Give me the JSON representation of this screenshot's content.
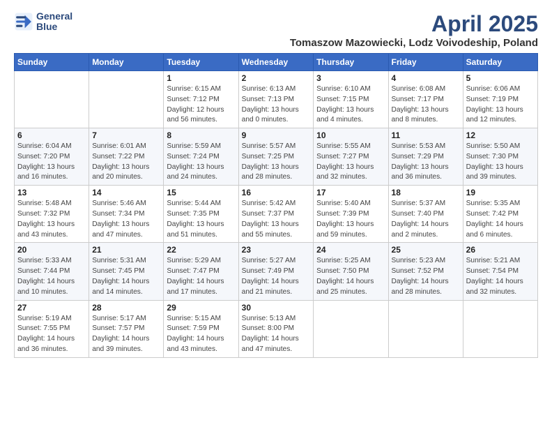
{
  "logo": {
    "line1": "General",
    "line2": "Blue"
  },
  "title": "April 2025",
  "subtitle": "Tomaszow Mazowiecki, Lodz Voivodeship, Poland",
  "header": {
    "days": [
      "Sunday",
      "Monday",
      "Tuesday",
      "Wednesday",
      "Thursday",
      "Friday",
      "Saturday"
    ]
  },
  "weeks": [
    [
      {
        "day": "",
        "info": ""
      },
      {
        "day": "",
        "info": ""
      },
      {
        "day": "1",
        "info": "Sunrise: 6:15 AM\nSunset: 7:12 PM\nDaylight: 12 hours and 56 minutes."
      },
      {
        "day": "2",
        "info": "Sunrise: 6:13 AM\nSunset: 7:13 PM\nDaylight: 13 hours and 0 minutes."
      },
      {
        "day": "3",
        "info": "Sunrise: 6:10 AM\nSunset: 7:15 PM\nDaylight: 13 hours and 4 minutes."
      },
      {
        "day": "4",
        "info": "Sunrise: 6:08 AM\nSunset: 7:17 PM\nDaylight: 13 hours and 8 minutes."
      },
      {
        "day": "5",
        "info": "Sunrise: 6:06 AM\nSunset: 7:19 PM\nDaylight: 13 hours and 12 minutes."
      }
    ],
    [
      {
        "day": "6",
        "info": "Sunrise: 6:04 AM\nSunset: 7:20 PM\nDaylight: 13 hours and 16 minutes."
      },
      {
        "day": "7",
        "info": "Sunrise: 6:01 AM\nSunset: 7:22 PM\nDaylight: 13 hours and 20 minutes."
      },
      {
        "day": "8",
        "info": "Sunrise: 5:59 AM\nSunset: 7:24 PM\nDaylight: 13 hours and 24 minutes."
      },
      {
        "day": "9",
        "info": "Sunrise: 5:57 AM\nSunset: 7:25 PM\nDaylight: 13 hours and 28 minutes."
      },
      {
        "day": "10",
        "info": "Sunrise: 5:55 AM\nSunset: 7:27 PM\nDaylight: 13 hours and 32 minutes."
      },
      {
        "day": "11",
        "info": "Sunrise: 5:53 AM\nSunset: 7:29 PM\nDaylight: 13 hours and 36 minutes."
      },
      {
        "day": "12",
        "info": "Sunrise: 5:50 AM\nSunset: 7:30 PM\nDaylight: 13 hours and 39 minutes."
      }
    ],
    [
      {
        "day": "13",
        "info": "Sunrise: 5:48 AM\nSunset: 7:32 PM\nDaylight: 13 hours and 43 minutes."
      },
      {
        "day": "14",
        "info": "Sunrise: 5:46 AM\nSunset: 7:34 PM\nDaylight: 13 hours and 47 minutes."
      },
      {
        "day": "15",
        "info": "Sunrise: 5:44 AM\nSunset: 7:35 PM\nDaylight: 13 hours and 51 minutes."
      },
      {
        "day": "16",
        "info": "Sunrise: 5:42 AM\nSunset: 7:37 PM\nDaylight: 13 hours and 55 minutes."
      },
      {
        "day": "17",
        "info": "Sunrise: 5:40 AM\nSunset: 7:39 PM\nDaylight: 13 hours and 59 minutes."
      },
      {
        "day": "18",
        "info": "Sunrise: 5:37 AM\nSunset: 7:40 PM\nDaylight: 14 hours and 2 minutes."
      },
      {
        "day": "19",
        "info": "Sunrise: 5:35 AM\nSunset: 7:42 PM\nDaylight: 14 hours and 6 minutes."
      }
    ],
    [
      {
        "day": "20",
        "info": "Sunrise: 5:33 AM\nSunset: 7:44 PM\nDaylight: 14 hours and 10 minutes."
      },
      {
        "day": "21",
        "info": "Sunrise: 5:31 AM\nSunset: 7:45 PM\nDaylight: 14 hours and 14 minutes."
      },
      {
        "day": "22",
        "info": "Sunrise: 5:29 AM\nSunset: 7:47 PM\nDaylight: 14 hours and 17 minutes."
      },
      {
        "day": "23",
        "info": "Sunrise: 5:27 AM\nSunset: 7:49 PM\nDaylight: 14 hours and 21 minutes."
      },
      {
        "day": "24",
        "info": "Sunrise: 5:25 AM\nSunset: 7:50 PM\nDaylight: 14 hours and 25 minutes."
      },
      {
        "day": "25",
        "info": "Sunrise: 5:23 AM\nSunset: 7:52 PM\nDaylight: 14 hours and 28 minutes."
      },
      {
        "day": "26",
        "info": "Sunrise: 5:21 AM\nSunset: 7:54 PM\nDaylight: 14 hours and 32 minutes."
      }
    ],
    [
      {
        "day": "27",
        "info": "Sunrise: 5:19 AM\nSunset: 7:55 PM\nDaylight: 14 hours and 36 minutes."
      },
      {
        "day": "28",
        "info": "Sunrise: 5:17 AM\nSunset: 7:57 PM\nDaylight: 14 hours and 39 minutes."
      },
      {
        "day": "29",
        "info": "Sunrise: 5:15 AM\nSunset: 7:59 PM\nDaylight: 14 hours and 43 minutes."
      },
      {
        "day": "30",
        "info": "Sunrise: 5:13 AM\nSunset: 8:00 PM\nDaylight: 14 hours and 47 minutes."
      },
      {
        "day": "",
        "info": ""
      },
      {
        "day": "",
        "info": ""
      },
      {
        "day": "",
        "info": ""
      }
    ]
  ]
}
